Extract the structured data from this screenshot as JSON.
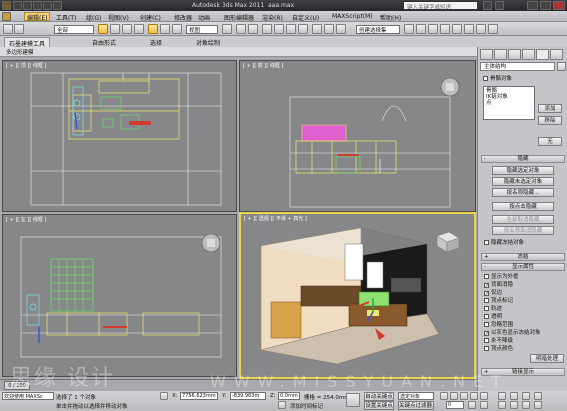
{
  "window": {
    "title": "Autodesk 3ds Max  2011",
    "filename": "aaa.max",
    "search_placeholder": "键入关键字或短语"
  },
  "menu": [
    "编辑(E)",
    "工具(T)",
    "组(G)",
    "视图(V)",
    "创建(C)",
    "修改器",
    "动画",
    "图形编辑器",
    "渲染(R)",
    "自定义(U)",
    "MAXScript(M)",
    "帮助(H)"
  ],
  "toolbar": {
    "filter_value": "全部",
    "refcoord_value": "视图",
    "selset_value": "创建选择集"
  },
  "ribbon": {
    "tabs": [
      "石墨建模工具",
      "自由形式",
      "选择",
      "对象绘制"
    ],
    "sub_label": "多边形建模"
  },
  "viewports": {
    "top": "[ + ][ 顶 ][ 线框 ]",
    "front": "[ + ][ 前 ][ 线框 ]",
    "left": "[ + ][ 左 ][ 线框 ]",
    "persp": "[ + ][ 透视 ][ 平滑 + 高光 ]"
  },
  "command_panel": {
    "rollout_main": "主体结构",
    "bone_obj_label": "骨骼对象",
    "list_items": [
      "骨骼",
      "IK链对象",
      "点"
    ],
    "add_btn": "添加",
    "remove_btn": "移除",
    "none_btn": "无",
    "hide_rollout": "隐藏",
    "hide_selected": "隐藏选定对象",
    "hide_unselected": "隐藏未选定对象",
    "hide_by_name": "按名称隐藏...",
    "hide_by_hit": "按点击隐藏",
    "unhide_all": "全部取消隐藏",
    "unhide_by_name": "按名称取消隐藏",
    "hide_frozen": "隐藏冻结对象",
    "freeze_rollout": "冻结",
    "display_props_rollout": "显示属性",
    "checkboxes": [
      {
        "label": "显示为外框",
        "checked": false
      },
      {
        "label": "背面消隐",
        "checked": true
      },
      {
        "label": "仅边",
        "checked": true
      },
      {
        "label": "顶点标记",
        "checked": false
      },
      {
        "label": "轨迹",
        "checked": false
      },
      {
        "label": "透明",
        "checked": false
      },
      {
        "label": "忽略范围",
        "checked": false
      },
      {
        "label": "以灰色显示冻结对象",
        "checked": true
      },
      {
        "label": "永不降级",
        "checked": false
      },
      {
        "label": "顶点颜色",
        "checked": false
      }
    ],
    "shaded_btn": "明暗处理",
    "link_display_rollout": "链接显示"
  },
  "timeline": {
    "frame_label": "0 / 100"
  },
  "status": {
    "welcome": "欢迎使用 MAXSc",
    "prompt": "单击并拖动以选择并移动对象",
    "selection_info": "选择了 1 个对象",
    "x_value": "7756.623mm",
    "y_value": "-839.963m",
    "z_value": "0.0mm",
    "grid": "栅格 = 254.0mm",
    "auto_key": "自动关键点",
    "set_key": "设置关键点",
    "key_filter": "关键点过滤器...",
    "add_time_tag": "添加时间标记",
    "selected_dropdown": "选定对象",
    "frame_field": "0"
  },
  "watermark": {
    "text": "思缘 设计",
    "url": "WWW.MISSYUAN.NET"
  },
  "colors": {
    "active_viewport": "#e8d64a",
    "wire_yellow": "#f1e86b",
    "wire_green": "#6fd86a",
    "wire_cyan": "#7ee0e8",
    "wire_magenta": "#e060d0",
    "wire_white": "#f0f0f0"
  }
}
